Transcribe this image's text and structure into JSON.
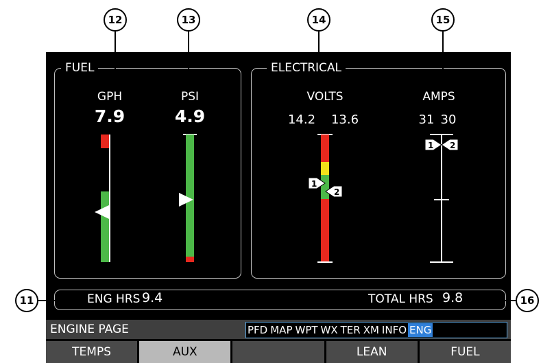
{
  "callouts": [
    "11",
    "12",
    "13",
    "14",
    "15",
    "16"
  ],
  "fuel": {
    "title": "FUEL",
    "gph": {
      "label": "GPH",
      "value": "7.9"
    },
    "psi": {
      "label": "PSI",
      "value": "4.9"
    }
  },
  "electrical": {
    "title": "ELECTRICAL",
    "volts": {
      "label": "VOLTS",
      "value1": "14.2",
      "value2": "13.6"
    },
    "amps": {
      "label": "AMPS",
      "value1": "31",
      "value2": "30"
    }
  },
  "pointers": {
    "one": "1",
    "two": "2"
  },
  "hours": {
    "eng_label": "ENG HRS",
    "eng_value": "9.4",
    "total_label": "TOTAL HRS",
    "total_value": "9.8"
  },
  "page_name": "ENGINE PAGE",
  "page_tabs": [
    "PFD",
    "MAP",
    "WPT",
    "WX",
    "TER",
    "XM",
    "INFO",
    "ENG"
  ],
  "active_tab": "ENG",
  "softkeys": [
    "TEMPS",
    "AUX",
    "",
    "LEAN",
    "FUEL"
  ],
  "selected_softkey": "AUX",
  "colors": {
    "green": "#4cb848",
    "red": "#e8281e",
    "yellow": "#f2e21a",
    "accent": "#2f7fd8"
  }
}
